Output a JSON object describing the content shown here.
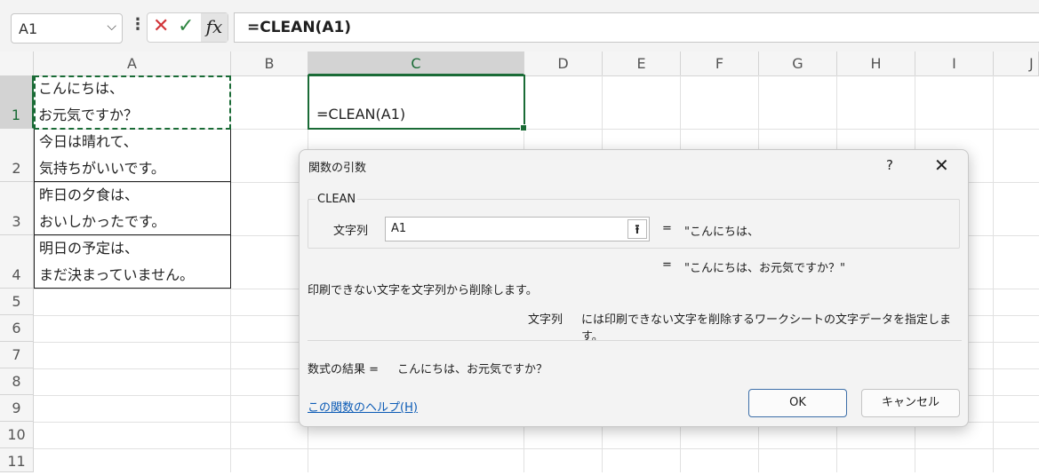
{
  "formula_bar": {
    "name_box": "A1",
    "formula": "=CLEAN(A1)",
    "fx": "fx"
  },
  "columns": [
    "A",
    "B",
    "C",
    "D",
    "E",
    "F",
    "G",
    "H",
    "I",
    "J"
  ],
  "rows": [
    "1",
    "2",
    "3",
    "4",
    "5",
    "6",
    "7",
    "8",
    "9",
    "10",
    "11"
  ],
  "cells": {
    "A1": [
      "こんにちは、",
      "お元気ですか？"
    ],
    "A2": [
      "今日は晴れて、",
      "気持ちがいいです。"
    ],
    "A3": [
      "昨日の夕食は、",
      "おいしかったです。"
    ],
    "A4": [
      "明日の予定は、",
      "まだ決まっていません。"
    ],
    "C1": "=CLEAN(A1)"
  },
  "dialog": {
    "title": "関数の引数",
    "help_glyph": "?",
    "close_glyph": "✕",
    "function_name": "CLEAN",
    "arg_label": "文字列",
    "arg_value": "A1",
    "eq": "=",
    "arg_result": "\"こんにちは、",
    "function_result": "\"こんにちは、お元気ですか？\"",
    "description": "印刷できない文字を文字列から削除します。",
    "arg_desc_label": "文字列",
    "arg_desc": "には印刷できない文字を削除するワークシートの文字データを指定します。",
    "result_label": "数式の結果 =",
    "result_value": "こんにちは、お元気ですか？",
    "help_link": "この関数のヘルプ(H)",
    "ok_label": "OK",
    "cancel_label": "キャンセル"
  }
}
